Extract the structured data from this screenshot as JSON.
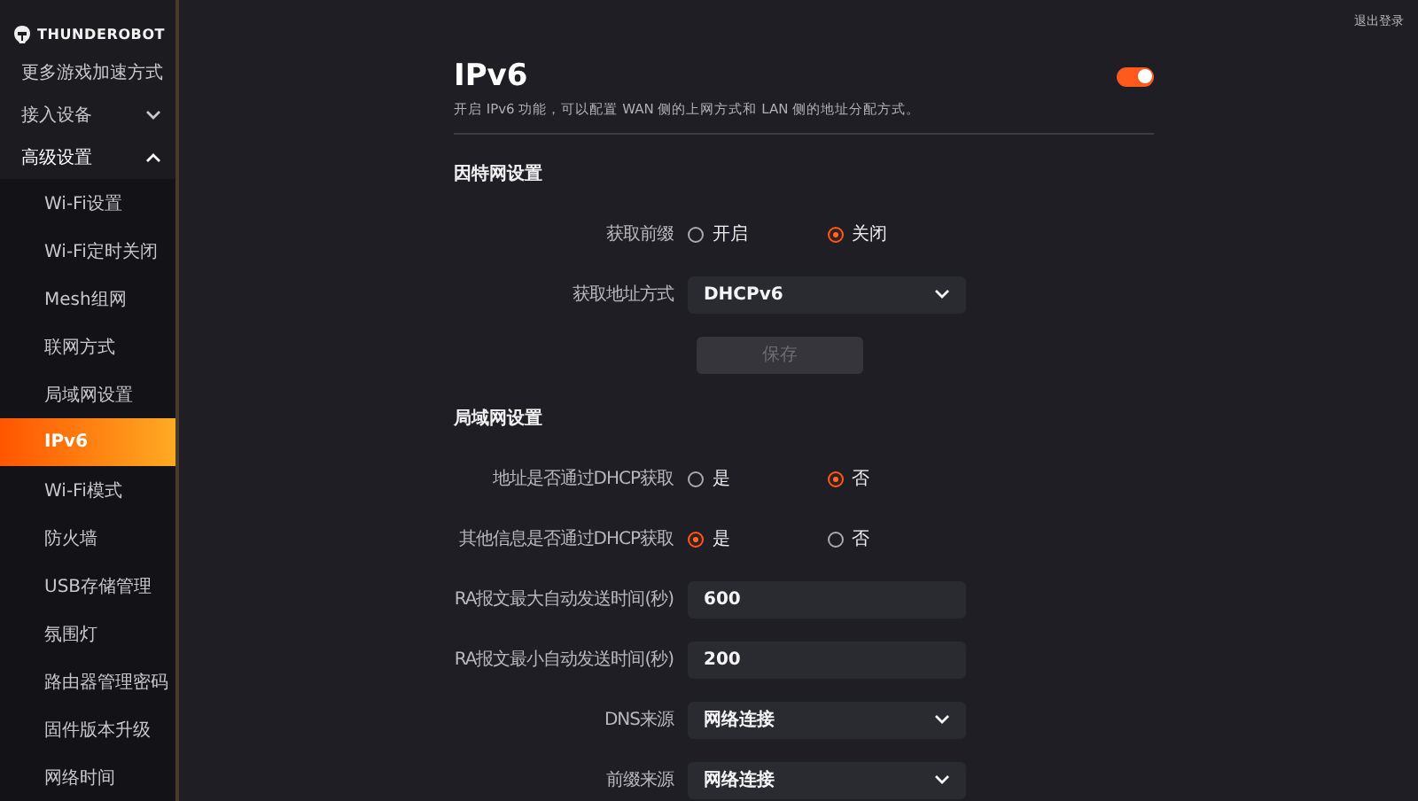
{
  "logo": {
    "text": "THUNDEROBOT"
  },
  "header": {
    "logout": "退出登录"
  },
  "sidebar": {
    "items": [
      {
        "kind": "link",
        "label": "更多游戏加速方式"
      },
      {
        "kind": "group",
        "label": "接入设备",
        "expanded": false
      },
      {
        "kind": "group",
        "label": "高级设置",
        "expanded": true,
        "children": [
          {
            "label": "Wi-Fi设置",
            "selected": false
          },
          {
            "label": "Wi-Fi定时关闭",
            "selected": false
          },
          {
            "label": "Mesh组网",
            "selected": false
          },
          {
            "label": "联网方式",
            "selected": false
          },
          {
            "label": "局域网设置",
            "selected": false
          },
          {
            "label": "IPv6",
            "selected": true
          },
          {
            "label": "Wi-Fi模式",
            "selected": false
          },
          {
            "label": "防火墙",
            "selected": false
          },
          {
            "label": "USB存储管理",
            "selected": false
          },
          {
            "label": "氛围灯",
            "selected": false
          },
          {
            "label": "路由器管理密码",
            "selected": false
          },
          {
            "label": "固件版本升级",
            "selected": false
          },
          {
            "label": "网络时间",
            "selected": false
          }
        ]
      }
    ]
  },
  "page": {
    "title": "IPv6",
    "enabled": true,
    "description": "开启 IPv6 功能，可以配置 WAN 侧的上网方式和 LAN 侧的地址分配方式。",
    "sections": [
      {
        "title": "因特网设置",
        "rows": [
          {
            "kind": "radio",
            "label": "获取前缀",
            "options": [
              {
                "label": "开启",
                "selected": false
              },
              {
                "label": "关闭",
                "selected": true
              }
            ]
          },
          {
            "kind": "select",
            "label": "获取地址方式",
            "value": "DHCPv6"
          },
          {
            "kind": "button",
            "label": "保存",
            "disabled": true
          }
        ]
      },
      {
        "title": "局域网设置",
        "rows": [
          {
            "kind": "radio",
            "label": "地址是否通过DHCP获取",
            "options": [
              {
                "label": "是",
                "selected": false
              },
              {
                "label": "否",
                "selected": true
              }
            ]
          },
          {
            "kind": "radio",
            "label": "其他信息是否通过DHCP获取",
            "options": [
              {
                "label": "是",
                "selected": true
              },
              {
                "label": "否",
                "selected": false
              }
            ]
          },
          {
            "kind": "input",
            "label": "RA报文最大自动发送时间(秒)",
            "value": "600"
          },
          {
            "kind": "input",
            "label": "RA报文最小自动发送时间(秒)",
            "value": "200"
          },
          {
            "kind": "select",
            "label": "DNS来源",
            "value": "网络连接"
          },
          {
            "kind": "select",
            "label": "前缀来源",
            "value": "网络连接"
          }
        ]
      }
    ]
  }
}
